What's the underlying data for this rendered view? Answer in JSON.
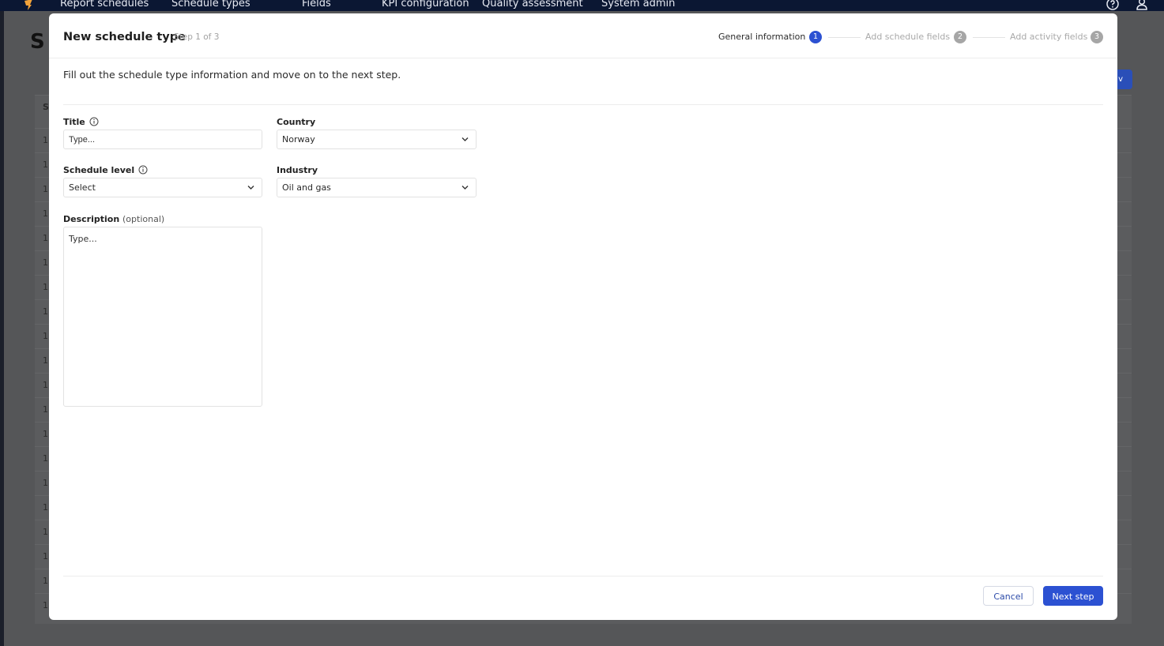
{
  "colors": {
    "nav_bg": "#0b1733",
    "accent": "#2c51d2",
    "overlay_bg": "#555658",
    "modal_bg": "#ffffff"
  },
  "topnav": {
    "logo": "app-logo-icon",
    "items": [
      {
        "label": "Report schedules"
      },
      {
        "label": "Schedule types"
      },
      {
        "label": "Fields"
      },
      {
        "label": "KPI configuration"
      },
      {
        "label": "Quality assessment"
      },
      {
        "label": "System admin"
      }
    ],
    "help_icon": "question-circle-icon",
    "user_icon": "user-icon"
  },
  "background": {
    "heading": "S",
    "new_button_label": "v",
    "table_header_cell": "S",
    "row_cell": "1:"
  },
  "modal": {
    "title": "New schedule type",
    "step_text": "Step 1 of 3",
    "stepper": [
      {
        "label": "General information",
        "number": "1",
        "state": "active"
      },
      {
        "label": "Add schedule fields",
        "number": "2",
        "state": "inactive"
      },
      {
        "label": "Add activity fields",
        "number": "3",
        "state": "inactive"
      }
    ],
    "intro": "Fill out the schedule type information and move on to the next step.",
    "form": {
      "title": {
        "label": "Title",
        "value": "",
        "placeholder": "Type..."
      },
      "country": {
        "label": "Country",
        "value": "Norway"
      },
      "schedule_level": {
        "label": "Schedule level",
        "value": "Select"
      },
      "industry": {
        "label": "Industry",
        "value": "Oil and gas"
      },
      "description": {
        "label": "Description",
        "optional": "(optional)",
        "value": "",
        "placeholder": "Type..."
      }
    },
    "footer": {
      "cancel_label": "Cancel",
      "next_label": "Next step"
    }
  }
}
